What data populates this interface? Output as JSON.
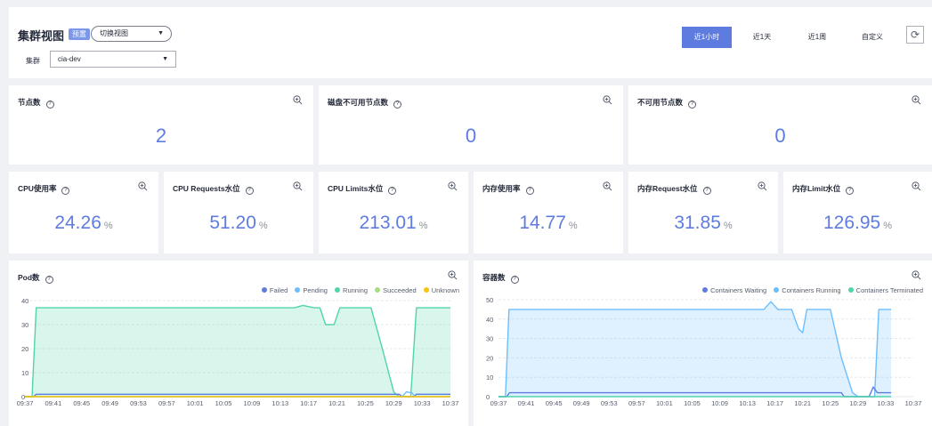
{
  "header": {
    "title": "集群视图",
    "badge": "预置",
    "switch_view": "切换视图",
    "cluster_label": "集群",
    "cluster_value": "cia-dev",
    "time_ranges": [
      "近1小时",
      "近1天",
      "近1周",
      "自定义"
    ],
    "active_range": "近1小时",
    "refresh_icon": "refresh-icon"
  },
  "top_metrics": [
    {
      "title": "节点数",
      "value": "2"
    },
    {
      "title": "磁盘不可用节点数",
      "value": "0"
    },
    {
      "title": "不可用节点数",
      "value": "0"
    }
  ],
  "pct_metrics": [
    {
      "title": "CPU使用率",
      "value": "24.26",
      "unit": "%"
    },
    {
      "title": "CPU Requests水位",
      "value": "51.20",
      "unit": "%"
    },
    {
      "title": "CPU Limits水位",
      "value": "213.01",
      "unit": "%"
    },
    {
      "title": "内存使用率",
      "value": "14.77",
      "unit": "%"
    },
    {
      "title": "内存Request水位",
      "value": "31.85",
      "unit": "%"
    },
    {
      "title": "内存Limit水位",
      "value": "126.95",
      "unit": "%"
    }
  ],
  "pod_chart": {
    "title": "Pod数",
    "legend": [
      {
        "name": "Failed",
        "color": "#5e7ce0"
      },
      {
        "name": "Pending",
        "color": "#6cbfff"
      },
      {
        "name": "Running",
        "color": "#50d4ab"
      },
      {
        "name": "Succeeded",
        "color": "#a6dd82"
      },
      {
        "name": "Unknown",
        "color": "#fac20a"
      }
    ]
  },
  "container_chart": {
    "title": "容器数",
    "legend": [
      {
        "name": "Containers Waiting",
        "color": "#5e7ce0"
      },
      {
        "name": "Containers Running",
        "color": "#6cbfff"
      },
      {
        "name": "Containers Terminated",
        "color": "#50d4ab"
      }
    ]
  },
  "chart_data": [
    {
      "type": "area",
      "title": "Pod数",
      "x": [
        "09:37",
        "09:41",
        "09:45",
        "09:49",
        "09:53",
        "09:57",
        "10:01",
        "10:05",
        "10:09",
        "10:13",
        "10:17",
        "10:21",
        "10:25",
        "10:29",
        "10:33",
        "10:37"
      ],
      "ylim": [
        0,
        40
      ],
      "yticks": [
        0,
        10,
        20,
        30,
        40
      ],
      "series": [
        {
          "name": "Running",
          "color": "#50d4ab",
          "points": [
            [
              0,
              0
            ],
            [
              0.25,
              0
            ],
            [
              0.4,
              37
            ],
            [
              9.5,
              37
            ],
            [
              9.8,
              38
            ],
            [
              10.2,
              37
            ],
            [
              10.4,
              37
            ],
            [
              10.6,
              30
            ],
            [
              10.9,
              30
            ],
            [
              11.1,
              37
            ],
            [
              12.2,
              37
            ],
            [
              12.6,
              20
            ],
            [
              13.0,
              2
            ],
            [
              13.2,
              0
            ],
            [
              13.6,
              0
            ],
            [
              13.8,
              37
            ],
            [
              15,
              37
            ]
          ]
        },
        {
          "name": "Failed",
          "color": "#5e7ce0",
          "points": [
            [
              0,
              0
            ],
            [
              0.3,
              0
            ],
            [
              0.4,
              1
            ],
            [
              13.2,
              1
            ],
            [
              13.3,
              0
            ],
            [
              13.7,
              0
            ],
            [
              13.8,
              1
            ],
            [
              15,
              1
            ]
          ]
        },
        {
          "name": "Pending",
          "color": "#6cbfff",
          "points": [
            [
              0,
              0
            ],
            [
              13.3,
              0
            ],
            [
              13.45,
              2
            ],
            [
              13.65,
              1.5
            ],
            [
              13.75,
              0
            ],
            [
              15,
              0
            ]
          ]
        },
        {
          "name": "Succeeded",
          "color": "#a6dd82",
          "points": [
            [
              0,
              0
            ],
            [
              15,
              0
            ]
          ]
        },
        {
          "name": "Unknown",
          "color": "#fac20a",
          "points": [
            [
              0,
              0
            ],
            [
              15,
              0
            ]
          ]
        }
      ]
    },
    {
      "type": "area",
      "title": "容器数",
      "x": [
        "09:37",
        "09:41",
        "09:45",
        "09:49",
        "09:53",
        "09:57",
        "10:01",
        "10:05",
        "10:09",
        "10:13",
        "10:17",
        "10:21",
        "10:25",
        "10:29",
        "10:33",
        "10:37"
      ],
      "ylim": [
        0,
        50
      ],
      "yticks": [
        0,
        10,
        20,
        30,
        40,
        50
      ],
      "series": [
        {
          "name": "Containers Running",
          "color": "#6cbfff",
          "points": [
            [
              0,
              0
            ],
            [
              0.25,
              0
            ],
            [
              0.38,
              45
            ],
            [
              9.6,
              45
            ],
            [
              9.85,
              49
            ],
            [
              10.1,
              45
            ],
            [
              10.6,
              45
            ],
            [
              10.85,
              35
            ],
            [
              11.0,
              33
            ],
            [
              11.15,
              45
            ],
            [
              12.0,
              45
            ],
            [
              12.4,
              20
            ],
            [
              12.8,
              2
            ],
            [
              13.0,
              0
            ],
            [
              13.6,
              0
            ],
            [
              13.75,
              45
            ],
            [
              14.2,
              45
            ]
          ]
        },
        {
          "name": "Containers Waiting",
          "color": "#5e7ce0",
          "points": [
            [
              0,
              0
            ],
            [
              0.3,
              0
            ],
            [
              0.4,
              2
            ],
            [
              12.4,
              2
            ],
            [
              12.5,
              0
            ],
            [
              13.4,
              0
            ],
            [
              13.55,
              5
            ],
            [
              13.7,
              2
            ],
            [
              14.2,
              2
            ]
          ]
        },
        {
          "name": "Containers Terminated",
          "color": "#50d4ab",
          "points": [
            [
              0,
              0
            ],
            [
              14.2,
              0
            ]
          ]
        }
      ]
    }
  ]
}
